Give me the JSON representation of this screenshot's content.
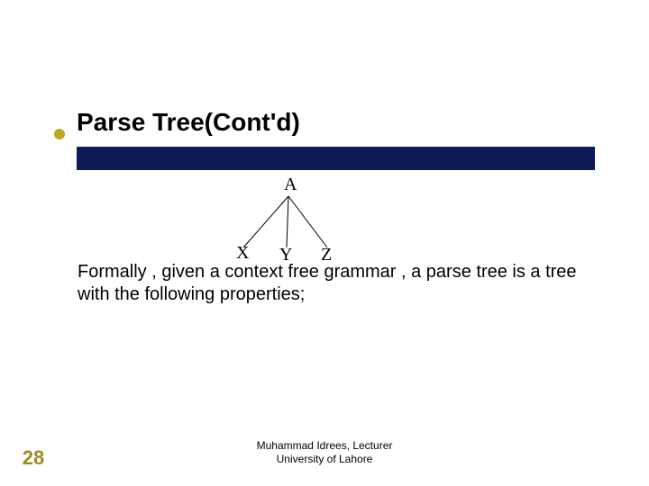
{
  "title": "Parse Tree(Cont'd)",
  "tree": {
    "root": "A",
    "children": {
      "left": "X",
      "mid": "Y",
      "right": "Z"
    }
  },
  "body": "Formally , given a context free grammar , a parse tree is a tree with the following properties;",
  "footer": {
    "line1": "Muhammad Idrees, Lecturer",
    "line2": "University of Lahore"
  },
  "page_number": "28"
}
